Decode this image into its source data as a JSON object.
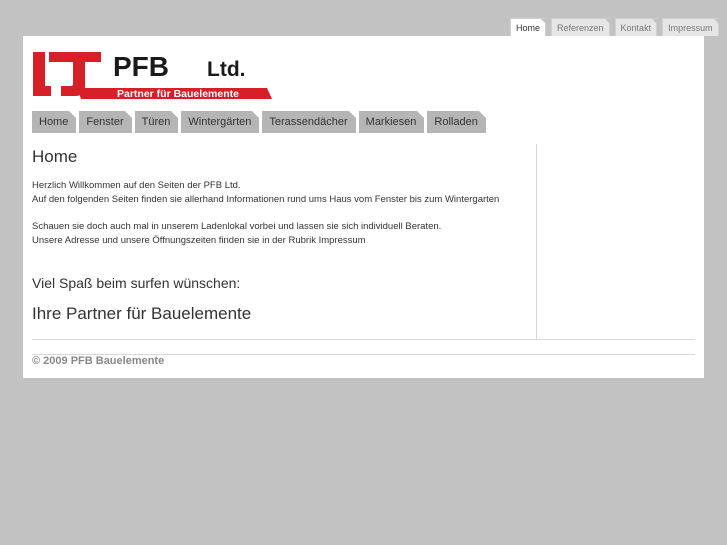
{
  "top_tabs": [
    {
      "label": "Home"
    },
    {
      "label": "Referenzen"
    },
    {
      "label": "Kontakt"
    },
    {
      "label": "Impressum"
    }
  ],
  "logo": {
    "name": "PFB",
    "suffix": "Ltd.",
    "tagline": "Partner für Bauelemente",
    "brand_color": "#d61f26"
  },
  "nav": [
    {
      "label": "Home"
    },
    {
      "label": "Fenster"
    },
    {
      "label": "Türen"
    },
    {
      "label": "Wintergärten"
    },
    {
      "label": "Terassendächer"
    },
    {
      "label": "Markiesen"
    },
    {
      "label": "Rolladen"
    }
  ],
  "content": {
    "title": "Home",
    "para1_line1": "Herzlich Willkommen auf den Seiten der PFB Ltd.",
    "para1_line2": "Auf den folgenden Seiten finden sie allerhand Informationen rund ums Haus vom Fenster bis zum Wintergarten",
    "para2_line1": "Schauen sie doch auch mal in unserem Ladenlokal vorbei und lassen sie sich individuell Beraten.",
    "para2_line2": "Unsere Adresse und unsere Öffnungszeiten finden sie in der Rubrik Impressum",
    "greeting": "Viel Spaß beim surfen wünschen:",
    "signature": "Ihre Partner für Bauelemente"
  },
  "footer": {
    "copyright": "© 2009 PFB Bauelemente"
  }
}
